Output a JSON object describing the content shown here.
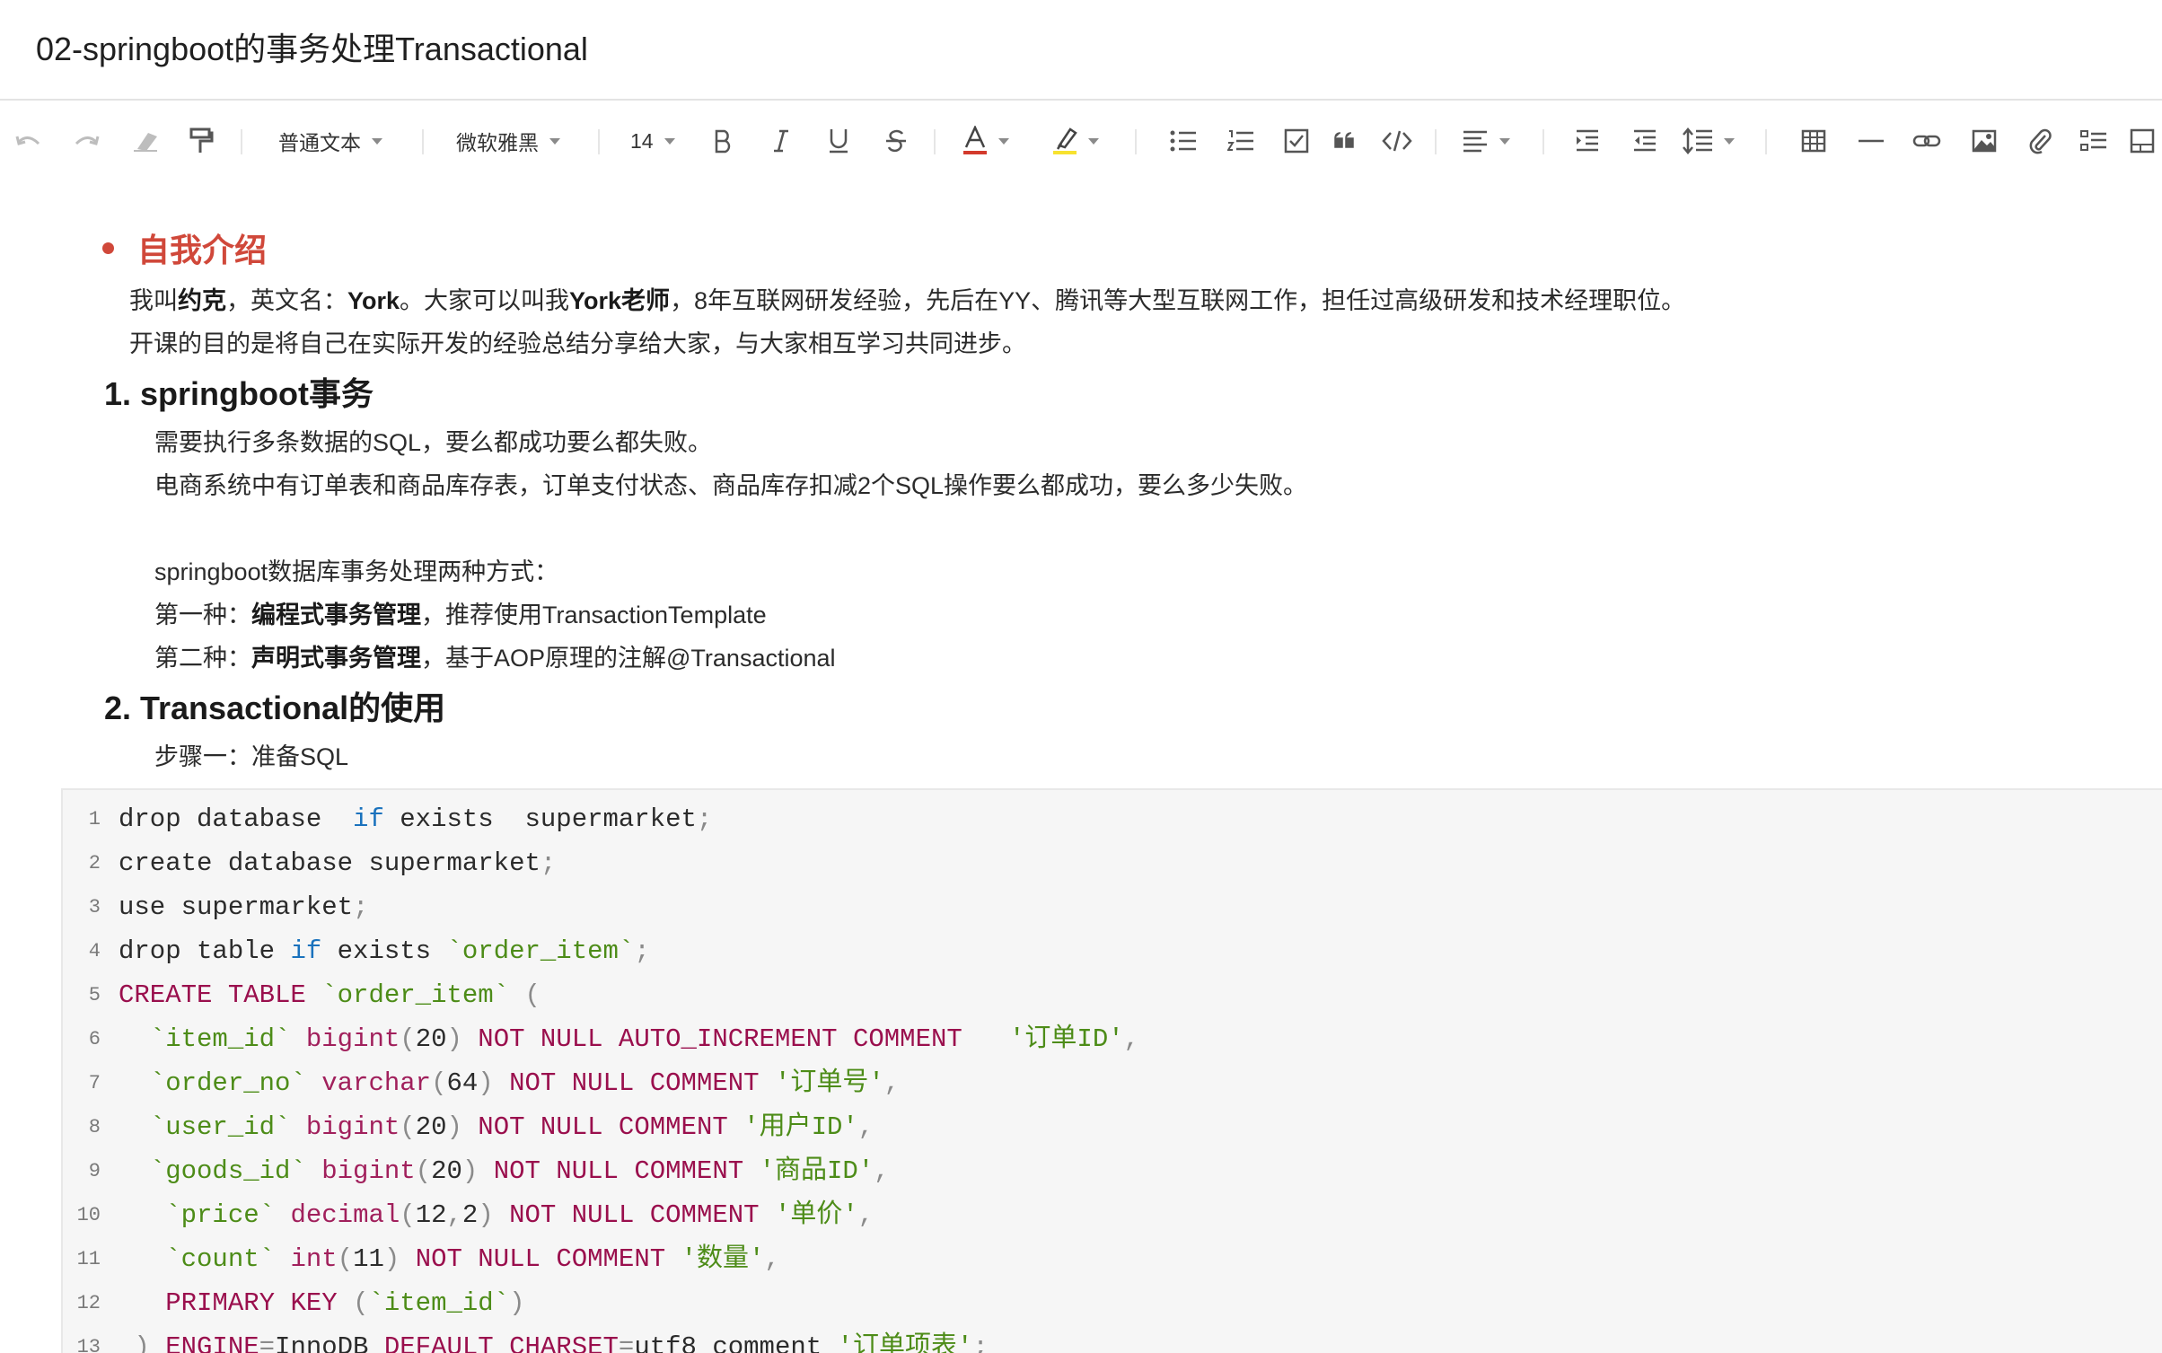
{
  "doc": {
    "title": "02-springboot的事务处理Transactional"
  },
  "toolbar": {
    "paragraph_style": "普通文本",
    "font_family": "微软雅黑",
    "font_size": "14",
    "icons": [
      "undo-icon",
      "redo-icon",
      "eraser-icon",
      "format-painter-icon",
      "bold-icon",
      "italic-icon",
      "underline-icon",
      "strikethrough-icon",
      "font-color-icon",
      "highlight-icon",
      "bullet-list-icon",
      "numbered-list-icon",
      "checklist-icon",
      "quote-icon",
      "code-icon",
      "align-icon",
      "indent-icon",
      "outdent-icon",
      "line-height-icon",
      "table-icon",
      "divider-icon",
      "link-icon",
      "image-icon",
      "attachment-icon",
      "more-icon",
      "layout-icon"
    ],
    "font_color": "#d33a2c",
    "highlight_color": "#f7e22f"
  },
  "content": {
    "intro_heading": "自我介绍",
    "intro_p1": [
      {
        "t": "我叫"
      },
      {
        "t": "约克",
        "b": true
      },
      {
        "t": "，英文名："
      },
      {
        "t": "York",
        "b": true
      },
      {
        "t": "。大家可以叫我"
      },
      {
        "t": "York老师",
        "b": true
      },
      {
        "t": "，8年互联网研发经验，先后在YY、腾讯等大型互联网工作，担任过高级研发和技术经理职位。"
      }
    ],
    "intro_p2": "开课的目的是将自己在实际开发的经验总结分享给大家，与大家相互学习共同进步。",
    "section1_heading": "1. springboot事务",
    "s1_p1": "需要执行多条数据的SQL，要么都成功要么都失败。",
    "s1_p2": "电商系统中有订单表和商品库存表，订单支付状态、商品库存扣减2个SQL操作要么都成功，要么多少失败。",
    "s1_p3": "springboot数据库事务处理两种方式：",
    "s1_p4": [
      {
        "t": "第一种："
      },
      {
        "t": "编程式事务管理",
        "b": true
      },
      {
        "t": "，推荐使用TransactionTemplate"
      }
    ],
    "s1_p5": [
      {
        "t": "第二种："
      },
      {
        "t": "声明式事务管理",
        "b": true
      },
      {
        "t": "，基于AOP原理的注解@Transactional"
      }
    ],
    "section2_heading": "2. Transactional的使用",
    "s2_p1": "步骤一：准备SQL"
  },
  "code": {
    "lines": [
      {
        "n": "1",
        "tokens": [
          {
            "t": "drop database  "
          },
          {
            "t": "if",
            "c": "kb"
          },
          {
            "t": " exists  supermarket"
          },
          {
            "t": ";",
            "c": "pn"
          }
        ]
      },
      {
        "n": "2",
        "tokens": [
          {
            "t": "create database supermarket"
          },
          {
            "t": ";",
            "c": "pn"
          }
        ]
      },
      {
        "n": "3",
        "tokens": [
          {
            "t": "use supermarket"
          },
          {
            "t": ";",
            "c": "pn"
          }
        ]
      },
      {
        "n": "4",
        "tokens": [
          {
            "t": "drop table "
          },
          {
            "t": "if",
            "c": "kb"
          },
          {
            "t": " exists "
          },
          {
            "t": "`order_item`",
            "c": "st"
          },
          {
            "t": ";",
            "c": "pn"
          }
        ]
      },
      {
        "n": "5",
        "tokens": [
          {
            "t": "CREATE TABLE ",
            "c": "kw"
          },
          {
            "t": "`order_item`",
            "c": "st"
          },
          {
            "t": " (",
            "c": "pn"
          }
        ]
      },
      {
        "n": "6",
        "tokens": [
          {
            "t": "  "
          },
          {
            "t": "`item_id`",
            "c": "st"
          },
          {
            "t": " "
          },
          {
            "t": "bigint",
            "c": "ty"
          },
          {
            "t": "(",
            "c": "pn"
          },
          {
            "t": "20"
          },
          {
            "t": ")",
            "c": "pn"
          },
          {
            "t": " NOT NULL AUTO_INCREMENT COMMENT   ",
            "c": "kw"
          },
          {
            "t": "'订单ID'",
            "c": "st"
          },
          {
            "t": ",",
            "c": "pn"
          }
        ]
      },
      {
        "n": "7",
        "tokens": [
          {
            "t": "  "
          },
          {
            "t": "`order_no`",
            "c": "st"
          },
          {
            "t": " "
          },
          {
            "t": "varchar",
            "c": "ty"
          },
          {
            "t": "(",
            "c": "pn"
          },
          {
            "t": "64"
          },
          {
            "t": ")",
            "c": "pn"
          },
          {
            "t": " NOT NULL COMMENT ",
            "c": "kw"
          },
          {
            "t": "'订单号'",
            "c": "st"
          },
          {
            "t": ",",
            "c": "pn"
          }
        ]
      },
      {
        "n": "8",
        "tokens": [
          {
            "t": "  "
          },
          {
            "t": "`user_id`",
            "c": "st"
          },
          {
            "t": " "
          },
          {
            "t": "bigint",
            "c": "ty"
          },
          {
            "t": "(",
            "c": "pn"
          },
          {
            "t": "20"
          },
          {
            "t": ")",
            "c": "pn"
          },
          {
            "t": " NOT NULL COMMENT ",
            "c": "kw"
          },
          {
            "t": "'用户ID'",
            "c": "st"
          },
          {
            "t": ",",
            "c": "pn"
          }
        ]
      },
      {
        "n": "9",
        "tokens": [
          {
            "t": "  "
          },
          {
            "t": "`goods_id`",
            "c": "st"
          },
          {
            "t": " "
          },
          {
            "t": "bigint",
            "c": "ty"
          },
          {
            "t": "(",
            "c": "pn"
          },
          {
            "t": "20"
          },
          {
            "t": ")",
            "c": "pn"
          },
          {
            "t": " NOT NULL COMMENT ",
            "c": "kw"
          },
          {
            "t": "'商品ID'",
            "c": "st"
          },
          {
            "t": ",",
            "c": "pn"
          }
        ]
      },
      {
        "n": "10",
        "tokens": [
          {
            "t": "   "
          },
          {
            "t": "`price`",
            "c": "st"
          },
          {
            "t": " "
          },
          {
            "t": "decimal",
            "c": "ty"
          },
          {
            "t": "(",
            "c": "pn"
          },
          {
            "t": "12"
          },
          {
            "t": ",",
            "c": "pn"
          },
          {
            "t": "2"
          },
          {
            "t": ")",
            "c": "pn"
          },
          {
            "t": " NOT NULL COMMENT ",
            "c": "kw"
          },
          {
            "t": "'单价'",
            "c": "st"
          },
          {
            "t": ",",
            "c": "pn"
          }
        ]
      },
      {
        "n": "11",
        "tokens": [
          {
            "t": "   "
          },
          {
            "t": "`count`",
            "c": "st"
          },
          {
            "t": " "
          },
          {
            "t": "int",
            "c": "ty"
          },
          {
            "t": "(",
            "c": "pn"
          },
          {
            "t": "11"
          },
          {
            "t": ")",
            "c": "pn"
          },
          {
            "t": " NOT NULL COMMENT ",
            "c": "kw"
          },
          {
            "t": "'数量'",
            "c": "st"
          },
          {
            "t": ",",
            "c": "pn"
          }
        ]
      },
      {
        "n": "12",
        "tokens": [
          {
            "t": "   "
          },
          {
            "t": "PRIMARY KEY ",
            "c": "kw"
          },
          {
            "t": "(",
            "c": "pn"
          },
          {
            "t": "`item_id`",
            "c": "st"
          },
          {
            "t": ")",
            "c": "pn"
          }
        ]
      },
      {
        "n": "13",
        "tokens": [
          {
            "t": " "
          },
          {
            "t": ")",
            "c": "pn"
          },
          {
            "t": " "
          },
          {
            "t": "ENGINE",
            "c": "kw"
          },
          {
            "t": "=",
            "c": "pn"
          },
          {
            "t": "InnoDB "
          },
          {
            "t": "DEFAULT CHARSET",
            "c": "kw"
          },
          {
            "t": "=",
            "c": "pn"
          },
          {
            "t": "utf8 comment "
          },
          {
            "t": "'订单项表'",
            "c": "st"
          },
          {
            "t": ";",
            "c": "pn"
          }
        ]
      }
    ]
  }
}
